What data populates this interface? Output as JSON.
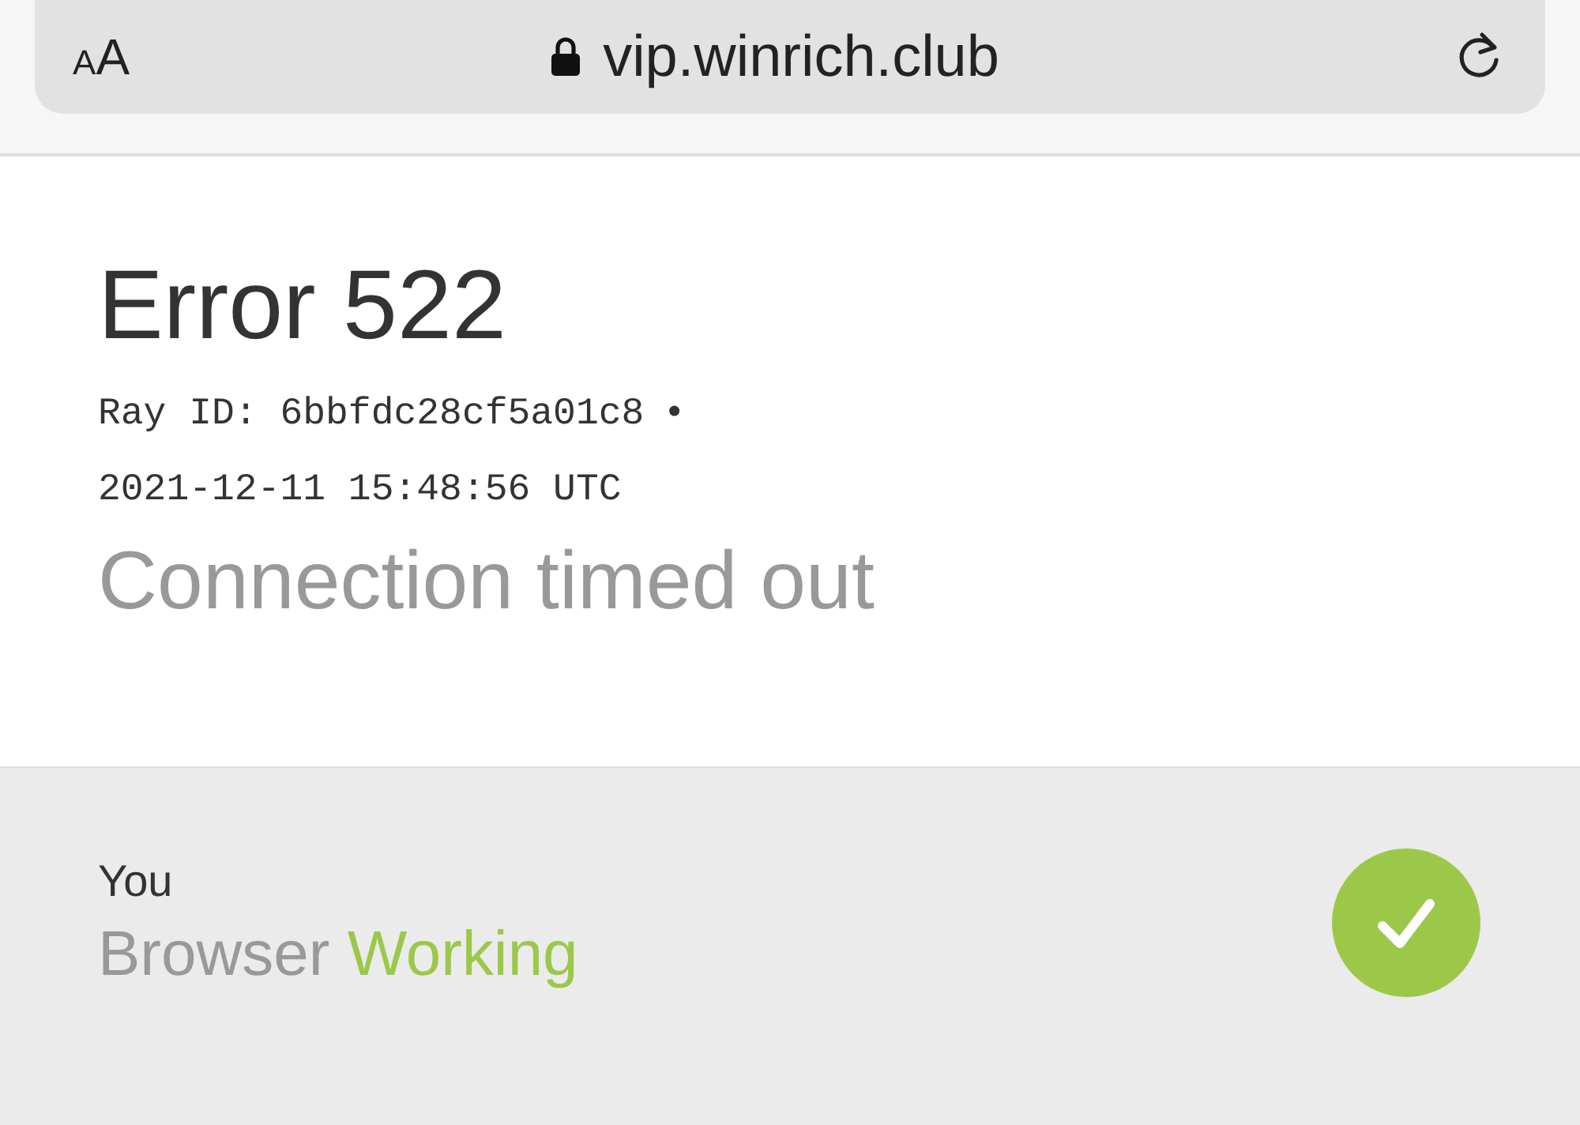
{
  "address_bar": {
    "text_size": [
      "A",
      "A"
    ],
    "url": "vip.winrich.club",
    "secure": true
  },
  "error": {
    "title": "Error 522",
    "ray_id": "Ray ID: 6bbfdc28cf5a01c8",
    "separator": "•",
    "timestamp": "2021-12-11 15:48:56 UTC",
    "message": "Connection timed out"
  },
  "status": {
    "label": "You",
    "name": "Browser",
    "state_text": "Working",
    "ok": true
  }
}
